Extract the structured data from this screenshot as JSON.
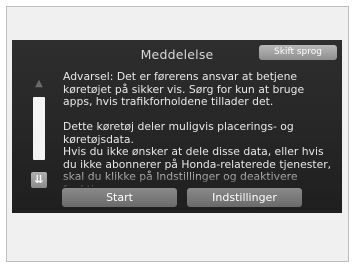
{
  "dialog": {
    "title": "Meddelelse",
    "language_button": "Skift sprog",
    "paragraphs": [
      "Advarsel: Det er førerens ansvar at betjene køretøjet på sikker vis. Sørg for kun at bruge apps, hvis trafikforholdene tillader det.",
      "Dette køretøj deler muligvis placerings- og køretøjsdata.",
      "Hvis du ikke ønsker at dele disse data, eller hvis du ikke abonnerer på Honda-relaterede tjenester, skal du klikke på Indstillinger og deaktivere funktionen."
    ],
    "start_button": "Start",
    "settings_button": "Indstillinger"
  },
  "icons": {
    "scroll_up": "chevron-up-icon",
    "scroll_down": "double-chevron-down-icon"
  },
  "colors": {
    "screen_background": "#262626",
    "text": "#e8e8e8",
    "button": "#7a7a7a",
    "scroll_track": "#f4f4f4"
  }
}
